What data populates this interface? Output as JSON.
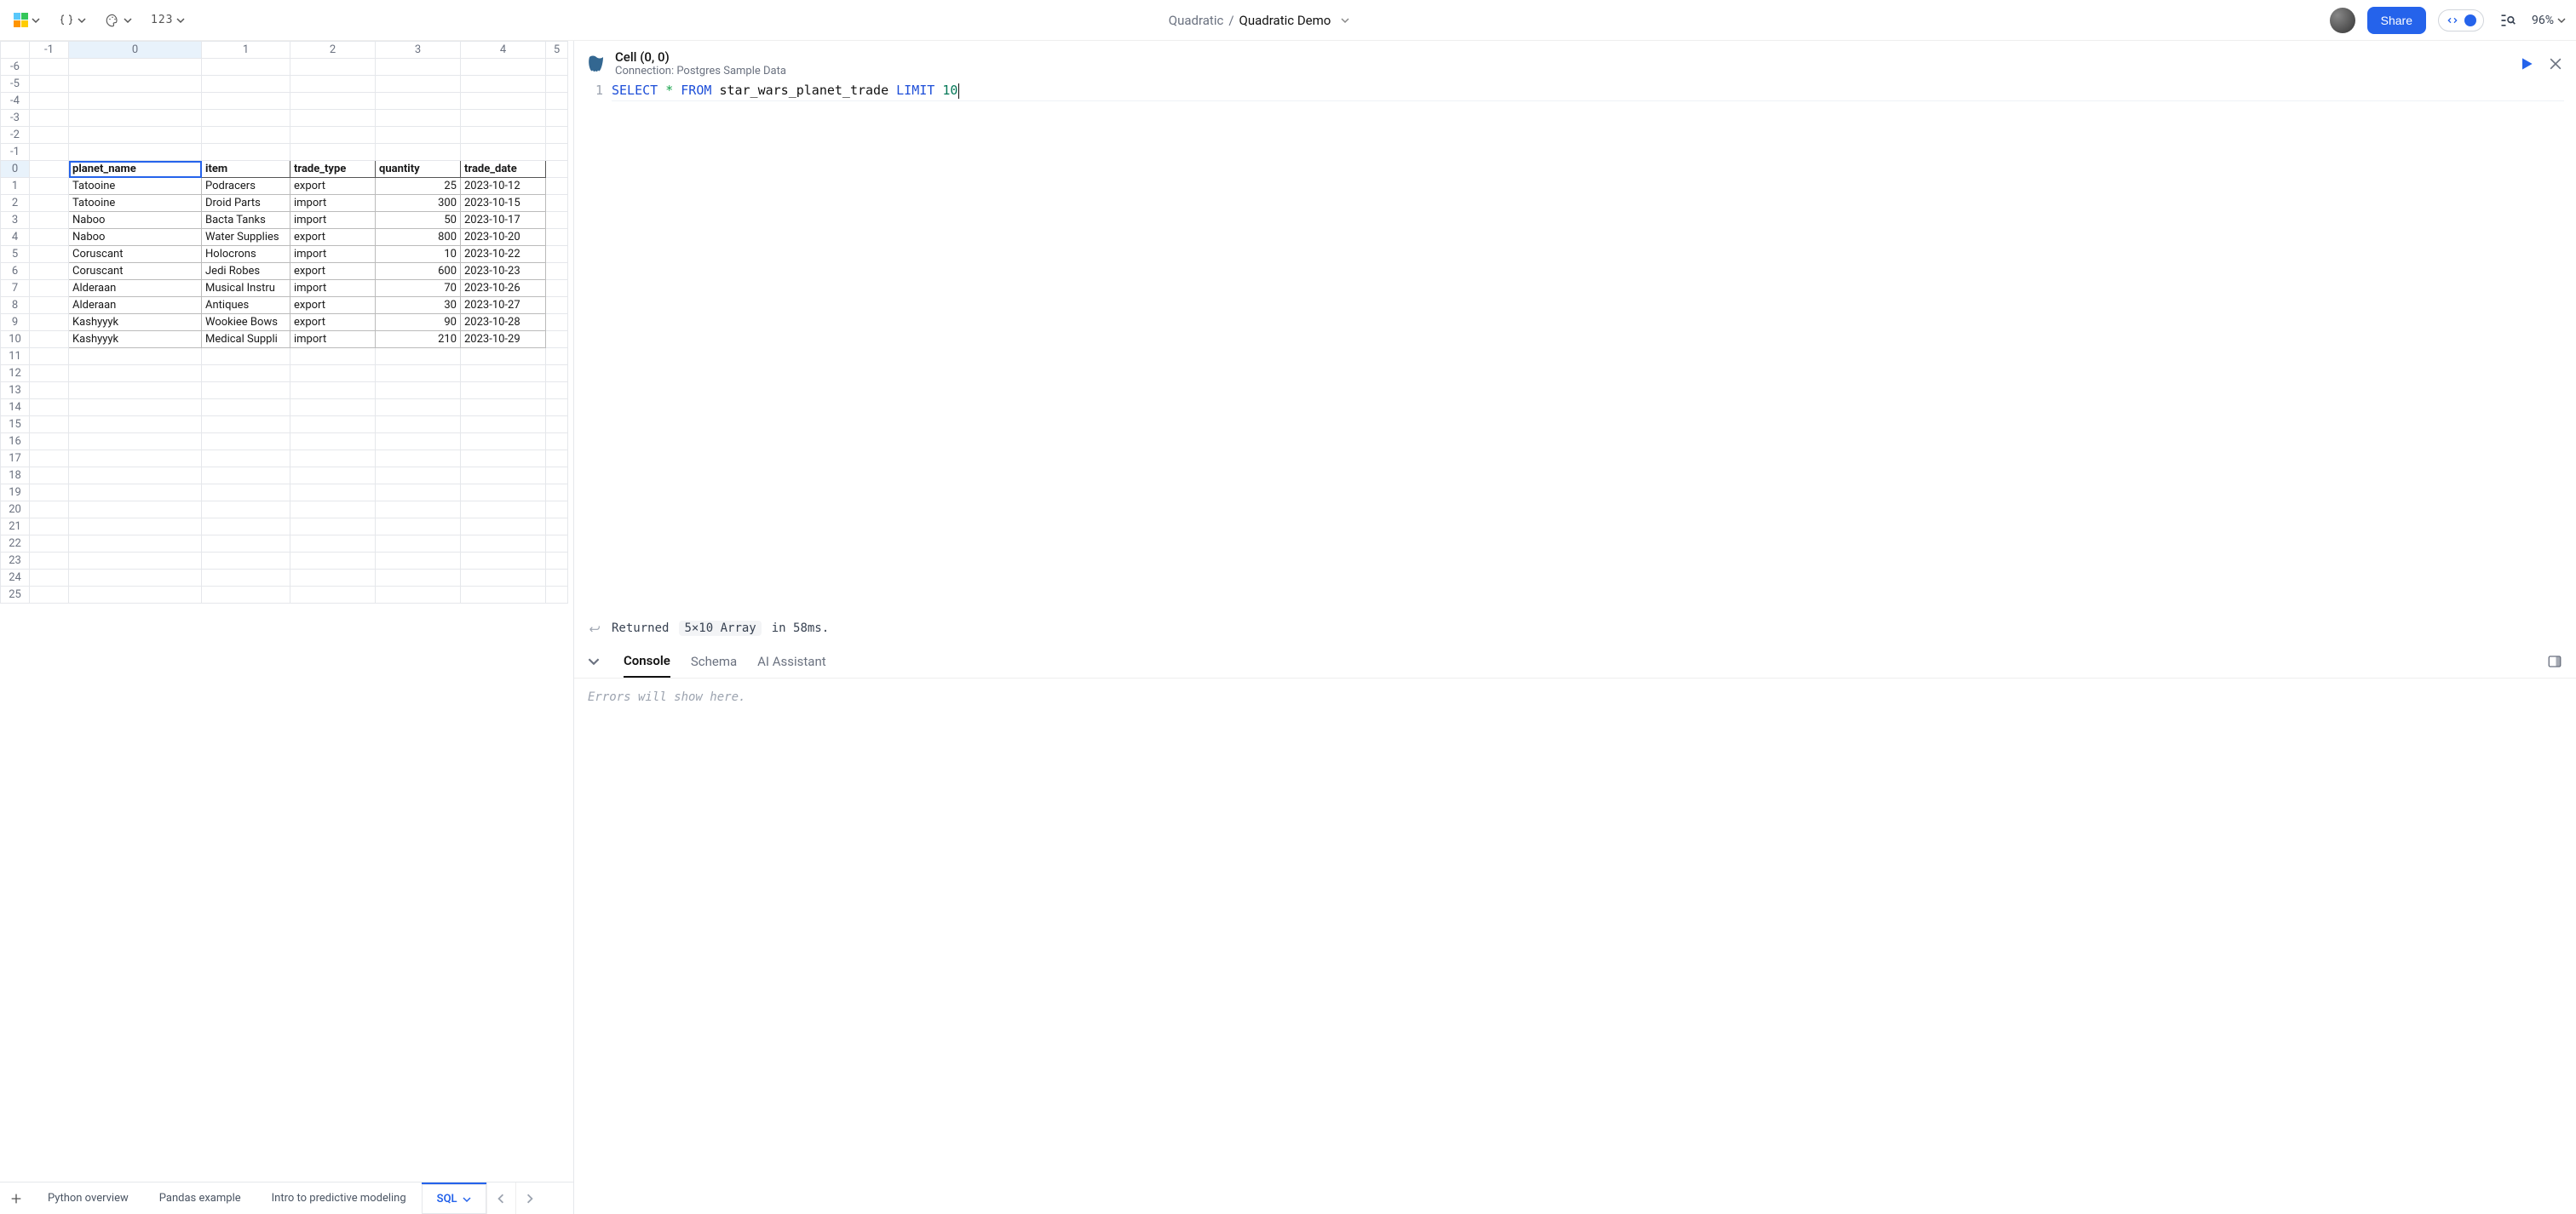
{
  "toolbar": {
    "number_format_label": "123"
  },
  "breadcrumb": {
    "workspace": "Quadratic",
    "file": "Quadratic Demo"
  },
  "share_label": "Share",
  "zoom_label": "96%",
  "grid": {
    "col_headers_start": -1,
    "col_headers_end": 5,
    "row_headers_start": -6,
    "row_headers_end": 25,
    "active_col": 0,
    "active_row": 0,
    "headers": [
      "planet_name",
      "item",
      "trade_type",
      "quantity",
      "trade_date"
    ],
    "rows": [
      [
        "Tatooine",
        "Podracers",
        "export",
        25,
        "2023-10-12"
      ],
      [
        "Tatooine",
        "Droid Parts",
        "import",
        300,
        "2023-10-15"
      ],
      [
        "Naboo",
        "Bacta Tanks",
        "import",
        50,
        "2023-10-17"
      ],
      [
        "Naboo",
        "Water Supplies",
        "export",
        800,
        "2023-10-20"
      ],
      [
        "Coruscant",
        "Holocrons",
        "import",
        10,
        "2023-10-22"
      ],
      [
        "Coruscant",
        "Jedi Robes",
        "export",
        600,
        "2023-10-23"
      ],
      [
        "Alderaan",
        "Musical Instru",
        "import",
        70,
        "2023-10-26"
      ],
      [
        "Alderaan",
        "Antiques",
        "export",
        30,
        "2023-10-27"
      ],
      [
        "Kashyyyk",
        "Wookiee Bows",
        "export",
        90,
        "2023-10-28"
      ],
      [
        "Kashyyyk",
        "Medical Suppli",
        "import",
        210,
        "2023-10-29"
      ]
    ]
  },
  "sheets": {
    "tabs": [
      "Python overview",
      "Pandas example",
      "Intro to predictive modeling",
      "SQL"
    ],
    "active_index": 3
  },
  "code_panel": {
    "title": "Cell (0, 0)",
    "subtitle": "Connection: Postgres Sample Data",
    "line_number": "1",
    "sql_tokens": {
      "select": "SELECT",
      "star": "*",
      "from": "FROM",
      "table": "star_wars_planet_trade",
      "limit": "LIMIT",
      "limit_n": "10"
    },
    "status": {
      "prefix": "Returned",
      "shape": "5×10 Array",
      "suffix": "in 58ms."
    },
    "tabs": [
      "Console",
      "Schema",
      "AI Assistant"
    ],
    "active_tab_index": 0,
    "console_placeholder": "Errors will show here."
  }
}
